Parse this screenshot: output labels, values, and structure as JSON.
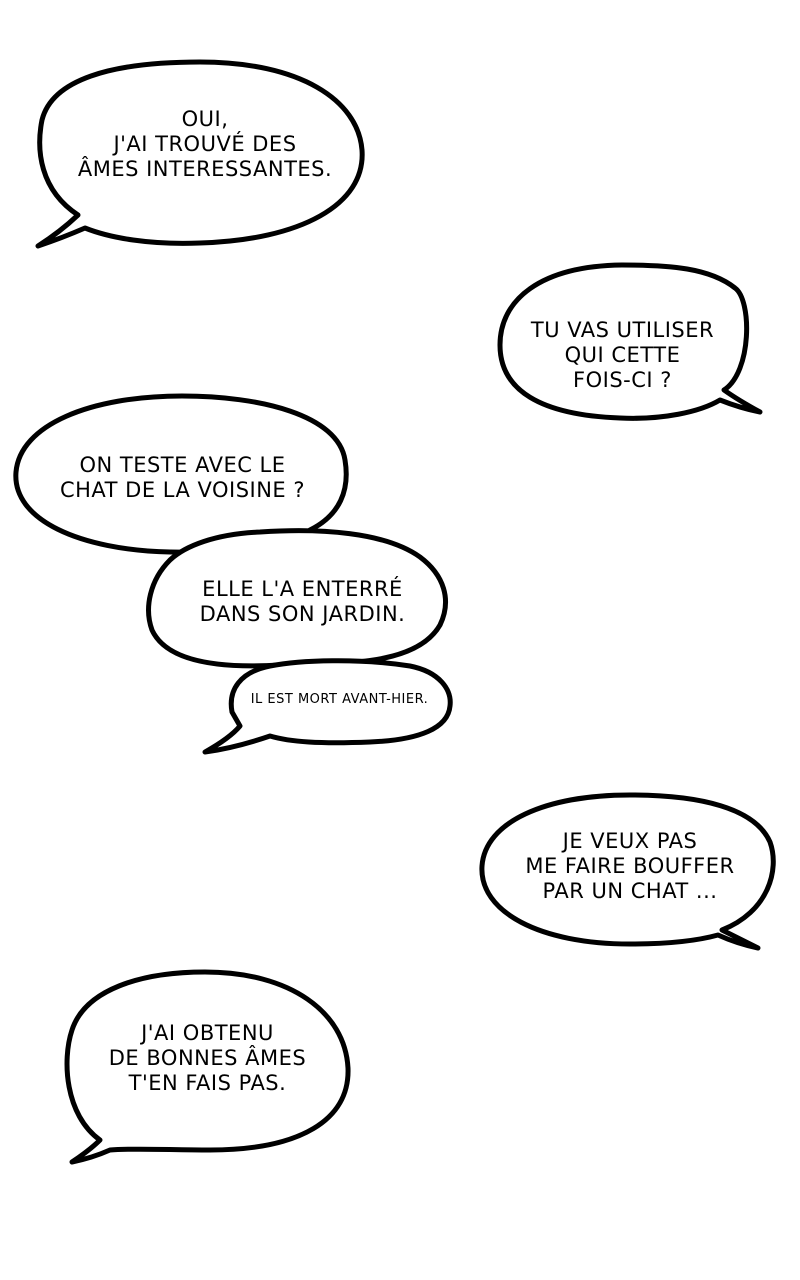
{
  "page": {
    "background_color": "#ffffff",
    "ink_color": "#000000"
  },
  "bubbles": [
    {
      "lines": [
        "OUI,",
        "J'AI TROUVÉ DES",
        "ÂMES INTERESSANTES."
      ]
    },
    {
      "lines": [
        "TU VAS UTILISER",
        "QUI CETTE",
        "FOIS-CI ?"
      ]
    },
    {
      "lines": [
        "ON TESTE AVEC LE",
        "CHAT DE LA VOISINE ?"
      ]
    },
    {
      "lines": [
        "ELLE L'A ENTERRÉ",
        "DANS SON JARDIN."
      ]
    },
    {
      "lines": [
        "IL EST MORT AVANT-HIER."
      ]
    },
    {
      "lines": [
        "JE VEUX PAS",
        "ME FAIRE BOUFFER",
        "PAR UN CHAT ..."
      ]
    },
    {
      "lines": [
        "J'AI OBTENU",
        "DE BONNES ÂMES",
        "T'EN FAIS PAS."
      ]
    }
  ]
}
